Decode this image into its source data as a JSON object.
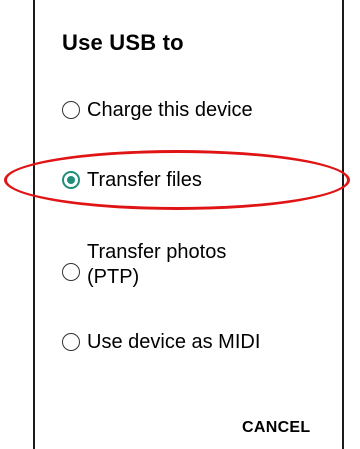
{
  "dialog": {
    "title": "Use USB to",
    "options": [
      {
        "label": "Charge this device",
        "selected": false
      },
      {
        "label": "Transfer files",
        "selected": true
      },
      {
        "label_line1": "Transfer photos",
        "label_line2": "(PTP)",
        "selected": false
      },
      {
        "label": "Use device as MIDI",
        "selected": false
      }
    ],
    "cancel_label": "CANCEL"
  },
  "colors": {
    "accent": "#1f8f7a",
    "annotation": "#e01414"
  }
}
